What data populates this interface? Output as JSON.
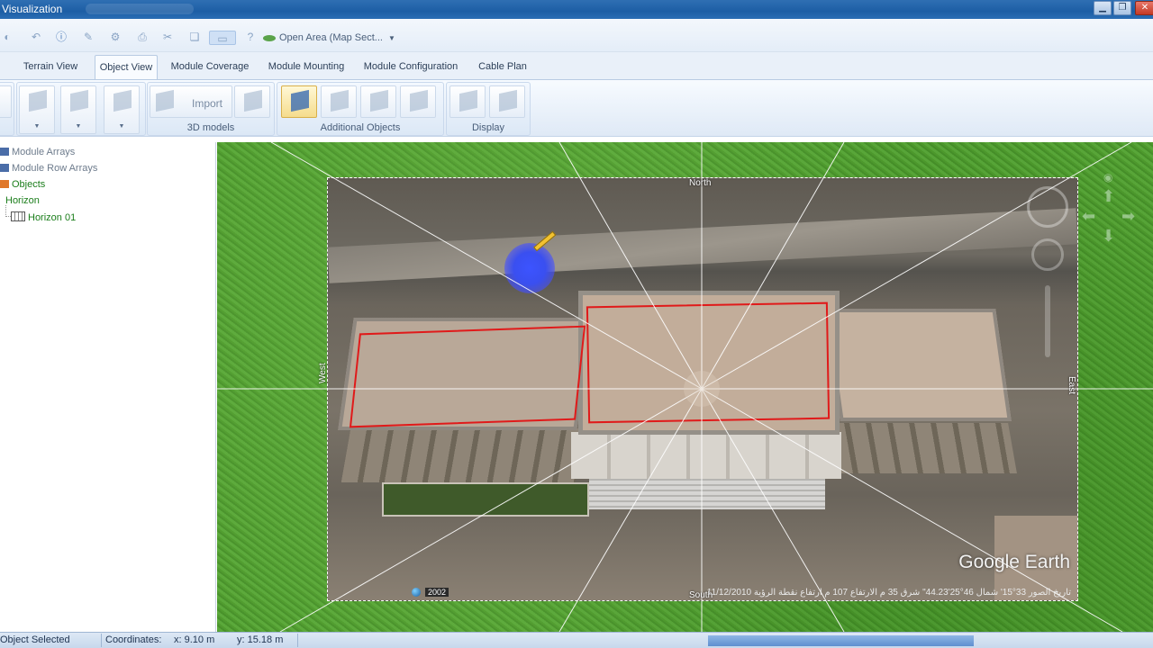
{
  "window": {
    "title": "Visualization"
  },
  "quick_access": {
    "open_area_label": "Open Area (Map Sect..."
  },
  "tabs": [
    {
      "label": "Terrain View"
    },
    {
      "label": "Object View"
    },
    {
      "label": "Module Coverage"
    },
    {
      "label": "Module Mounting"
    },
    {
      "label": "Module Configuration"
    },
    {
      "label": "Cable Plan"
    }
  ],
  "selected_tab": "Object View",
  "ribbon": {
    "import_label": "Import",
    "groups": [
      {
        "label": "3D models"
      },
      {
        "label": "Additional Objects"
      },
      {
        "label": "Display"
      }
    ]
  },
  "tree": {
    "items": [
      {
        "label": "Module Arrays"
      },
      {
        "label": "Module Row Arrays"
      },
      {
        "label": "Objects"
      },
      {
        "label": "Horizon"
      },
      {
        "label": "Horizon 01"
      }
    ]
  },
  "viewport": {
    "compass": {
      "north": "North",
      "south": "South",
      "west": "West",
      "east": "East"
    },
    "watermark": "Google Earth",
    "imagery_year": "2002",
    "attribution": "11/12/2010   تاريخ الصور   33°15'   شمال   46°25'44.23\"   شرق   35 م   الارتفاع   107 م   ارتفاع نقطة الرؤية",
    "colors": {
      "grass": "#55a236",
      "outline": "#e01a1a",
      "cursor": "#3c54ff"
    }
  },
  "statusbar": {
    "selection": "Object Selected",
    "coordinates_label": "Coordinates:",
    "x": "x: 9.10 m",
    "y": "y: 15.18 m"
  },
  "colors": {
    "titlebar": "#1d5ea5",
    "ribbon": "#dfe9f6",
    "tree_green": "#1a7d1a"
  }
}
